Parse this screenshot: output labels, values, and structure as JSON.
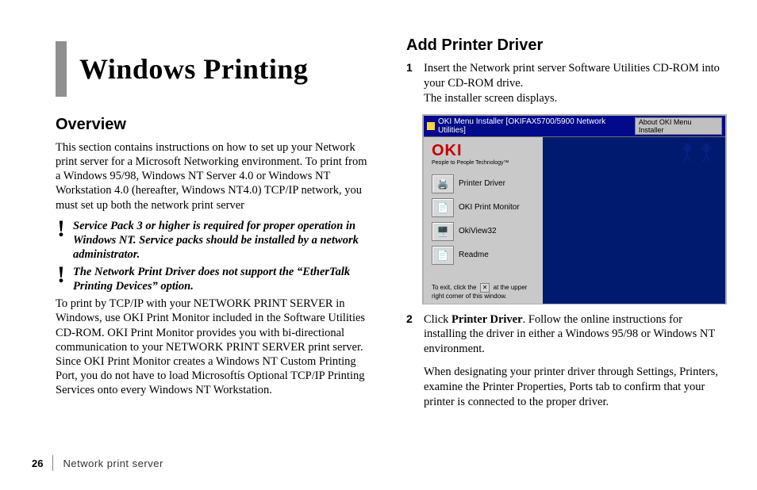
{
  "left": {
    "chapter_title": "Windows Printing",
    "h_overview": "Overview",
    "p1": "This section contains instructions on how to set up your Network print server for a Microsoft Networking environment. To print from a Windows 95/98, Windows NT Server 4.0 or Windows NT Workstation 4.0 (hereafter, Windows NT4.0) TCP/IP network, you must set up both the network print server",
    "note1": "Service Pack 3 or higher is required for proper operation in Windows NT. Service packs should be installed by a network administrator.",
    "note2": "The Network Print Driver does not support the “EtherTalk Printing Devices” option.",
    "p2": "To print by TCP/IP with your NETWORK PRINT SERVER in Windows, use OKI Print Monitor included in the Software Utilities CD-ROM. OKI Print Monitor provides you with bi-directional communication to your NETWORK PRINT SERVER print server. Since OKI Print Monitor creates a Windows NT Custom Printing Port, you do not have to load Microsoftís Optional TCP/IP Printing Services onto every Windows NT Workstation."
  },
  "right": {
    "h_add": "Add Printer Driver",
    "step1_num": "1",
    "step1_a": "Insert the Network print server Software Utilities CD-ROM into your CD-ROM drive.",
    "step1_b": "The installer screen displays.",
    "step2_num": "2",
    "step2_a_pre": "Click ",
    "step2_a_bold": "Printer Driver",
    "step2_a_post": ". Follow the online instructions for installing the driver in either a Windows 95/98 or Windows NT environment.",
    "step2_b": "When designating your printer driver through Settings, Printers, examine the Printer Properties, Ports tab to confirm that your printer is connected to the proper driver."
  },
  "installer": {
    "title": "OKI Menu Installer [OKIFAX5700/5900 Network Utilities]",
    "about_btn": "About OKI Menu Installer",
    "logo": "OKI",
    "tagline": "People to People Technology™",
    "items": [
      {
        "icon": "🖨️",
        "label": "Printer Driver"
      },
      {
        "icon": "📄",
        "label": "OKI Print Monitor"
      },
      {
        "icon": "🖥️",
        "label": "OkiView32"
      },
      {
        "icon": "📄",
        "label": "Readme"
      }
    ],
    "exit_pre": "To exit, click the ",
    "exit_x": "✕",
    "exit_post": " at the upper right corner of this window."
  },
  "footer": {
    "page_number": "26",
    "book_title": "Network print server"
  }
}
